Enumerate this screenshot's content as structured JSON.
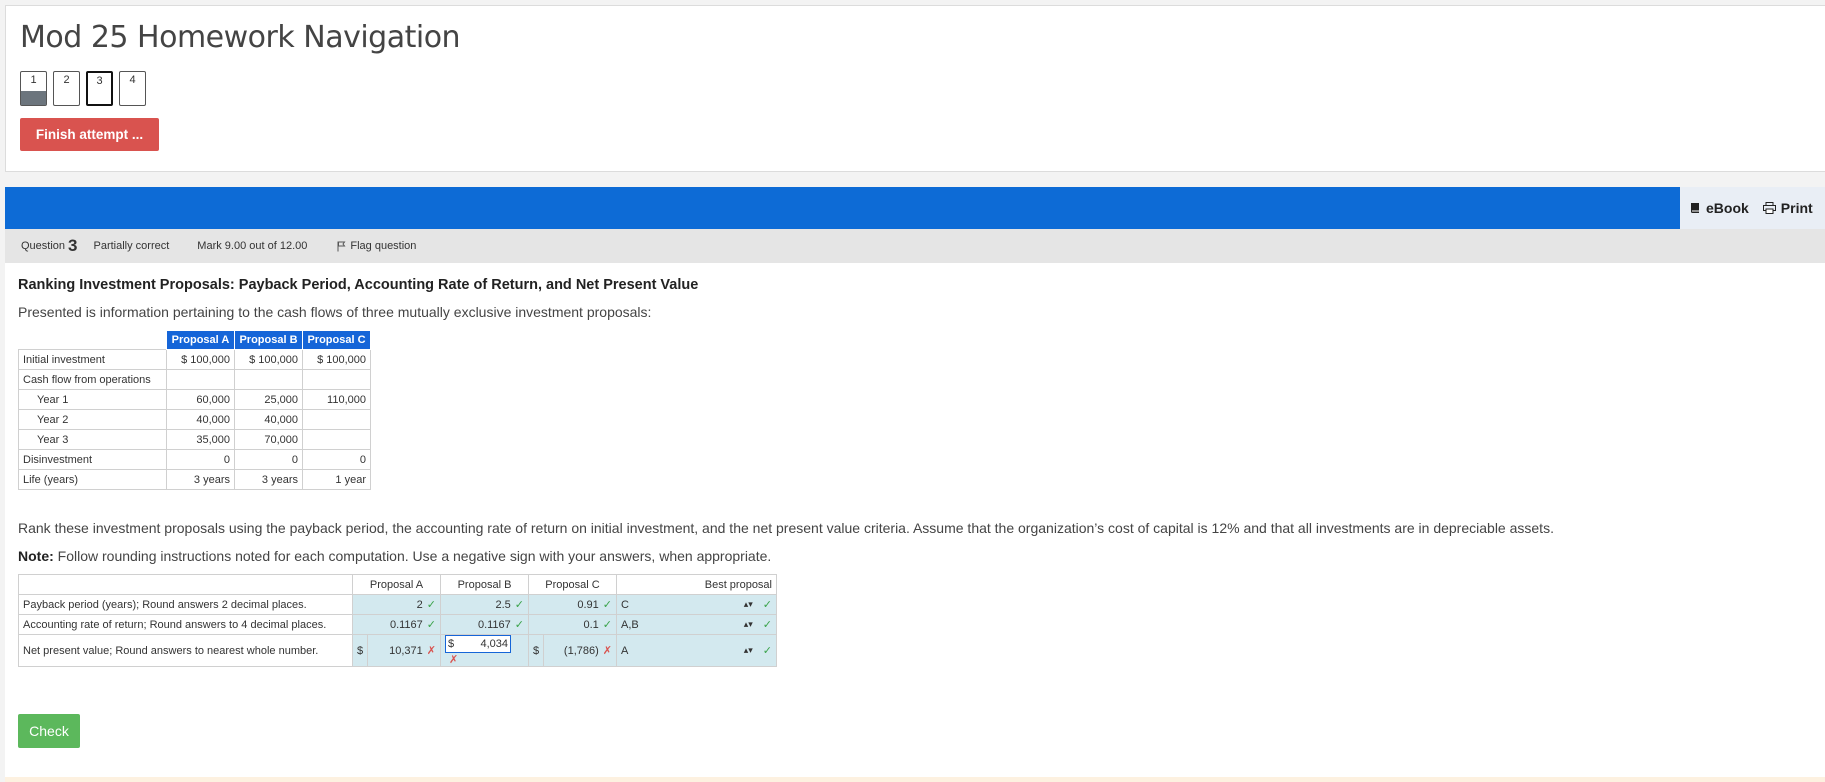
{
  "nav": {
    "title": "Mod 25 Homework Navigation",
    "questions": [
      "1",
      "2",
      "3",
      "4"
    ],
    "finish_label": "Finish attempt ..."
  },
  "tools": {
    "ebook": "eBook",
    "print": "Print"
  },
  "info": {
    "question_prefix": "Question",
    "question_number": "3",
    "state": "Partially correct",
    "grade": "Mark 9.00 out of 12.00",
    "flag": "Flag question"
  },
  "content": {
    "title": "Ranking Investment Proposals: Payback Period, Accounting Rate of Return, and Net Present Value",
    "intro": "Presented is information pertaining to the cash flows of three mutually exclusive investment proposals:",
    "table1": {
      "headers": [
        "Proposal A",
        "Proposal B",
        "Proposal C"
      ],
      "rows": [
        {
          "label": "Initial investment",
          "cells": [
            "$ 100,000",
            "$ 100,000",
            "$ 100,000"
          ]
        },
        {
          "label": "Cash flow from operations",
          "cells": [
            "",
            "",
            ""
          ]
        },
        {
          "label": "Year 1",
          "cells": [
            "60,000",
            "25,000",
            "110,000"
          ]
        },
        {
          "label": "Year 2",
          "cells": [
            "40,000",
            "40,000",
            ""
          ]
        },
        {
          "label": "Year 3",
          "cells": [
            "35,000",
            "70,000",
            ""
          ]
        },
        {
          "label": "Disinvestment",
          "cells": [
            "0",
            "0",
            "0"
          ]
        },
        {
          "label": "Life (years)",
          "cells": [
            "3 years",
            "3 years",
            "1 year"
          ]
        }
      ]
    },
    "rank_text": "Rank these investment proposals using the payback period, the accounting rate of return on initial investment, and the net present value criteria. Assume that the organization’s cost of capital is 12% and that all investments are in depreciable assets.",
    "note_label": "Note:",
    "note_text": " Follow rounding instructions noted for each computation.  Use a negative sign with your answers, when appropriate.",
    "table2": {
      "headers": [
        "Proposal A",
        "Proposal B",
        "Proposal C",
        "Best proposal"
      ],
      "rows": [
        {
          "label": "Payback period (years); Round answers 2 decimal places.",
          "a": "2",
          "b": "2.5",
          "c": "0.91",
          "best": "C"
        },
        {
          "label": "Accounting rate of return; Round answers to 4 decimal places.",
          "a": "0.1167",
          "b": "0.1167",
          "c": "0.1",
          "best": "A,B"
        },
        {
          "label": "Net present value; Round answers to nearest whole number.",
          "a": "10,371",
          "b": "4,034",
          "c": "(1,786)",
          "best": "A"
        }
      ],
      "currency": "$"
    },
    "check_label": "Check"
  }
}
